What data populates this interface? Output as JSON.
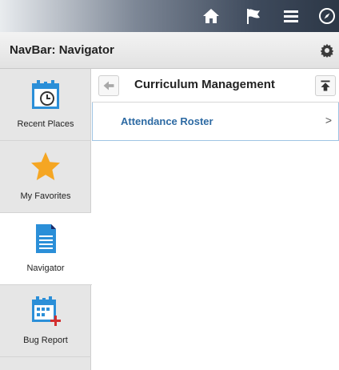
{
  "topbar": {
    "icons": [
      "home-icon",
      "flag-icon",
      "menu-icon",
      "compass-icon"
    ]
  },
  "navbar": {
    "title": "NavBar: Navigator"
  },
  "sidebar": {
    "items": [
      {
        "label": "Recent Places",
        "icon": "calendar-clock-icon"
      },
      {
        "label": "My Favorites",
        "icon": "star-icon"
      },
      {
        "label": "Navigator",
        "icon": "document-icon",
        "active": true
      },
      {
        "label": "Bug Report",
        "icon": "calendar-plus-icon"
      }
    ]
  },
  "content": {
    "title": "Curriculum Management",
    "rows": [
      {
        "label": "Attendance Roster"
      }
    ]
  },
  "colors": {
    "accent": "#2d6aa3",
    "icon_blue": "#2b8fd8",
    "star": "#f5a623",
    "bug_plus": "#d32f2f"
  }
}
